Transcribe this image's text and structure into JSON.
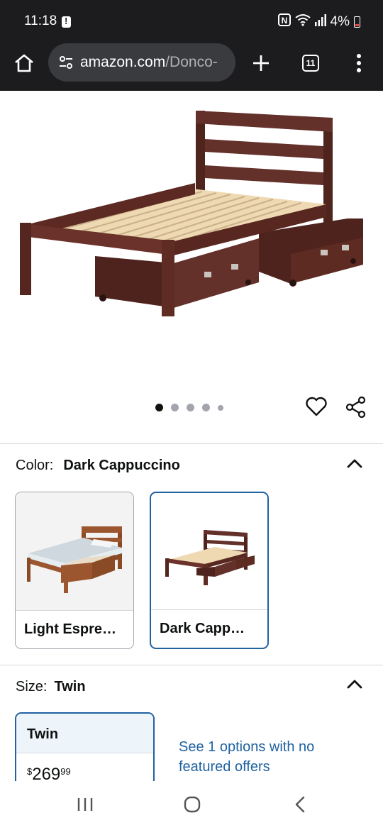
{
  "status": {
    "time": "11:18",
    "battery": "4%"
  },
  "browser": {
    "url_host": "amazon.com",
    "url_path": "/Donco-",
    "tab_count": "11"
  },
  "gallery": {
    "image_count": 5,
    "active_index": 0
  },
  "color": {
    "label": "Color:",
    "value": "Dark Cappuccino",
    "options": [
      {
        "label": "Light Espre…"
      },
      {
        "label": "Dark Capp…"
      }
    ]
  },
  "size": {
    "label": "Size:",
    "value": "Twin",
    "options": [
      {
        "name": "Twin",
        "price_symbol": "$",
        "price_whole": "269",
        "price_fraction": "99"
      }
    ],
    "see_more": "See 1 options with no featured offers"
  },
  "colors": {
    "accent": "#2162a1",
    "bar": "#1c1c1e",
    "wood_dark": "#5a2a22",
    "slat": "#eed9b3"
  }
}
